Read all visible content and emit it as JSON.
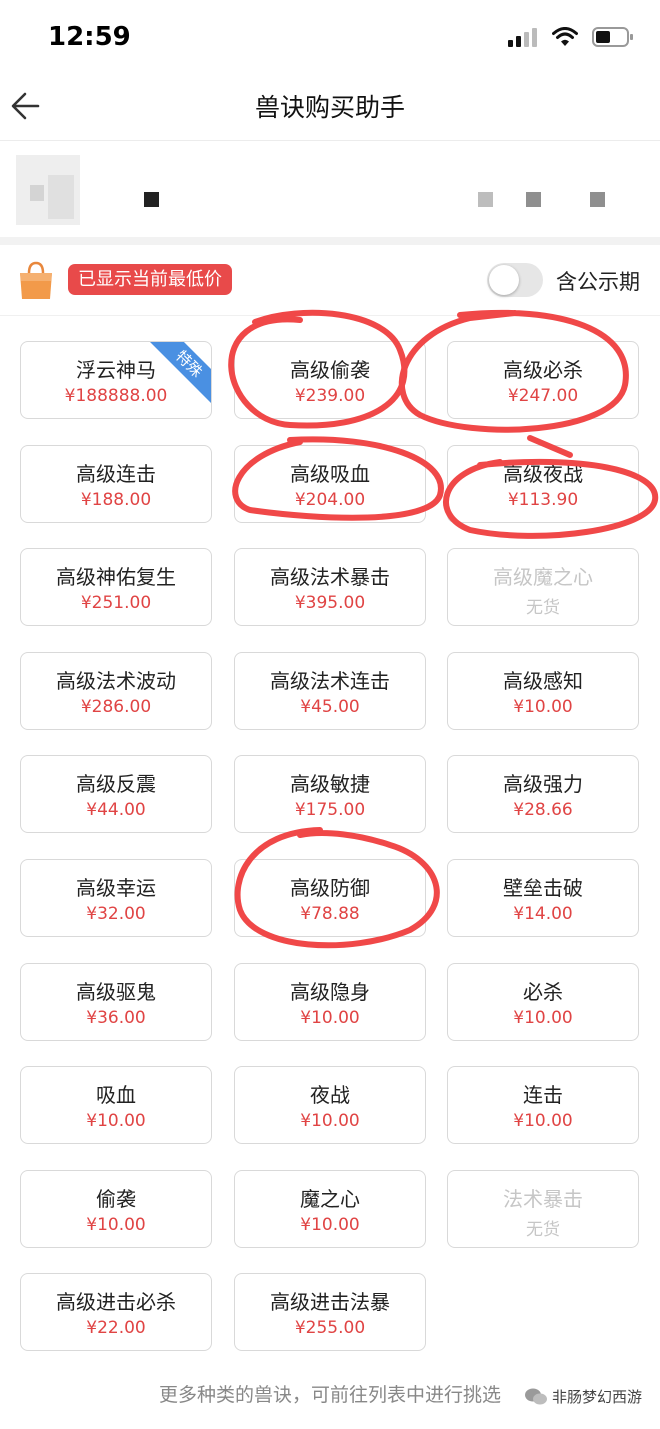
{
  "status": {
    "time": "12:59"
  },
  "nav": {
    "title": "兽诀购买助手"
  },
  "info": {
    "badge": "已显示当前最低价",
    "toggle_label": "含公示期",
    "toggle_on": false
  },
  "items": [
    {
      "name": "浮云神马",
      "price": "¥188888.00",
      "tag": "特殊",
      "available": true
    },
    {
      "name": "高级偷袭",
      "price": "¥239.00",
      "available": true
    },
    {
      "name": "高级必杀",
      "price": "¥247.00",
      "available": true
    },
    {
      "name": "高级连击",
      "price": "¥188.00",
      "available": true
    },
    {
      "name": "高级吸血",
      "price": "¥204.00",
      "available": true
    },
    {
      "name": "高级夜战",
      "price": "¥113.90",
      "available": true
    },
    {
      "name": "高级神佑复生",
      "price": "¥251.00",
      "available": true
    },
    {
      "name": "高级法术暴击",
      "price": "¥395.00",
      "available": true
    },
    {
      "name": "高级魔之心",
      "price": "无货",
      "available": false
    },
    {
      "name": "高级法术波动",
      "price": "¥286.00",
      "available": true
    },
    {
      "name": "高级法术连击",
      "price": "¥45.00",
      "available": true
    },
    {
      "name": "高级感知",
      "price": "¥10.00",
      "available": true
    },
    {
      "name": "高级反震",
      "price": "¥44.00",
      "available": true
    },
    {
      "name": "高级敏捷",
      "price": "¥175.00",
      "available": true
    },
    {
      "name": "高级强力",
      "price": "¥28.66",
      "available": true
    },
    {
      "name": "高级幸运",
      "price": "¥32.00",
      "available": true
    },
    {
      "name": "高级防御",
      "price": "¥78.88",
      "available": true
    },
    {
      "name": "壁垒击破",
      "price": "¥14.00",
      "available": true
    },
    {
      "name": "高级驱鬼",
      "price": "¥36.00",
      "available": true
    },
    {
      "name": "高级隐身",
      "price": "¥10.00",
      "available": true
    },
    {
      "name": "必杀",
      "price": "¥10.00",
      "available": true
    },
    {
      "name": "吸血",
      "price": "¥10.00",
      "available": true
    },
    {
      "name": "夜战",
      "price": "¥10.00",
      "available": true
    },
    {
      "name": "连击",
      "price": "¥10.00",
      "available": true
    },
    {
      "name": "偷袭",
      "price": "¥10.00",
      "available": true
    },
    {
      "name": "魔之心",
      "price": "¥10.00",
      "available": true
    },
    {
      "name": "法术暴击",
      "price": "无货",
      "available": false
    },
    {
      "name": "高级进击必杀",
      "price": "¥22.00",
      "available": true
    },
    {
      "name": "高级进击法暴",
      "price": "¥255.00",
      "available": true
    }
  ],
  "footer": {
    "note": "更多种类的兽诀，可前往列表中进行挑选",
    "watermark": "非肠梦幻西游"
  },
  "colors": {
    "price": "#e04444",
    "badge": "#e84a4a",
    "ribbon": "#4a90e2",
    "annotation": "#f04848"
  }
}
